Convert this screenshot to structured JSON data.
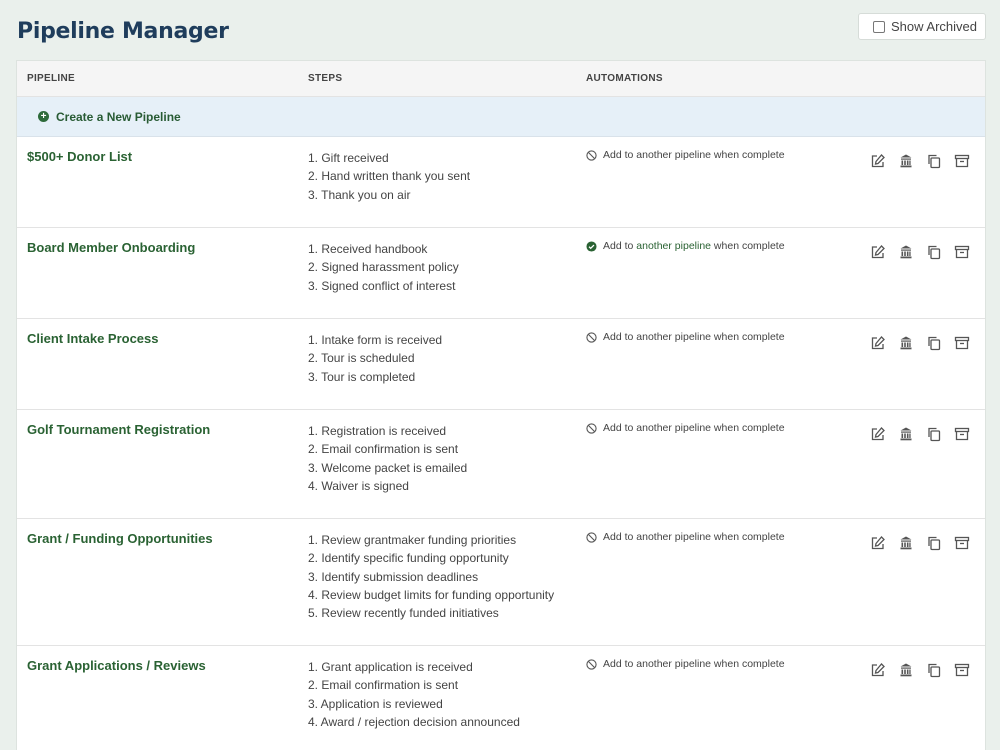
{
  "header": {
    "title": "Pipeline Manager",
    "show_archived_label": "Show Archived"
  },
  "table": {
    "columns": {
      "pipeline": "PIPELINE",
      "steps": "STEPS",
      "automations": "AUTOMATIONS"
    },
    "create_label": "Create a New Pipeline",
    "rows": [
      {
        "name": "$500+ Donor List",
        "steps": [
          "1. Gift received",
          "2. Hand written thank you sent",
          "3. Thank you on air"
        ],
        "automation": {
          "active": false,
          "prefix": "Add to ",
          "link": "another pipeline",
          "suffix": " when complete"
        }
      },
      {
        "name": "Board Member Onboarding",
        "steps": [
          "1. Received handbook",
          "2. Signed harassment policy",
          "3. Signed conflict of interest"
        ],
        "automation": {
          "active": true,
          "prefix": "Add to ",
          "link": "another pipeline",
          "suffix": " when complete"
        }
      },
      {
        "name": "Client Intake Process",
        "steps": [
          "1. Intake form is received",
          "2. Tour is scheduled",
          "3. Tour is completed"
        ],
        "automation": {
          "active": false,
          "prefix": "Add to ",
          "link": "another pipeline",
          "suffix": " when complete"
        }
      },
      {
        "name": "Golf Tournament Registration",
        "steps": [
          "1. Registration is received",
          "2. Email confirmation is sent",
          "3. Welcome packet is emailed",
          "4. Waiver is signed"
        ],
        "automation": {
          "active": false,
          "prefix": "Add to ",
          "link": "another pipeline",
          "suffix": " when complete"
        }
      },
      {
        "name": "Grant / Funding Opportunities",
        "steps": [
          "1. Review grantmaker funding priorities",
          "2. Identify specific funding opportunity",
          "3. Identify submission deadlines",
          "4. Review budget limits for funding opportunity",
          "5. Review recently funded initiatives"
        ],
        "automation": {
          "active": false,
          "prefix": "Add to ",
          "link": "another pipeline",
          "suffix": " when complete"
        }
      },
      {
        "name": "Grant Applications / Reviews",
        "steps": [
          "1. Grant application is received",
          "2. Email confirmation is sent",
          "3. Application is reviewed",
          "4. Award / rejection decision announced"
        ],
        "automation": {
          "active": false,
          "prefix": "Add to ",
          "link": "another pipeline",
          "suffix": " when complete"
        }
      }
    ]
  },
  "row_action_icons": [
    "edit-icon",
    "museum-icon",
    "copy-icon",
    "archive-icon"
  ],
  "colors": {
    "title": "#1f3d5c",
    "accent_green": "#2a6233",
    "create_bg": "#e6f0f8",
    "page_bg": "#eaf0ec"
  }
}
